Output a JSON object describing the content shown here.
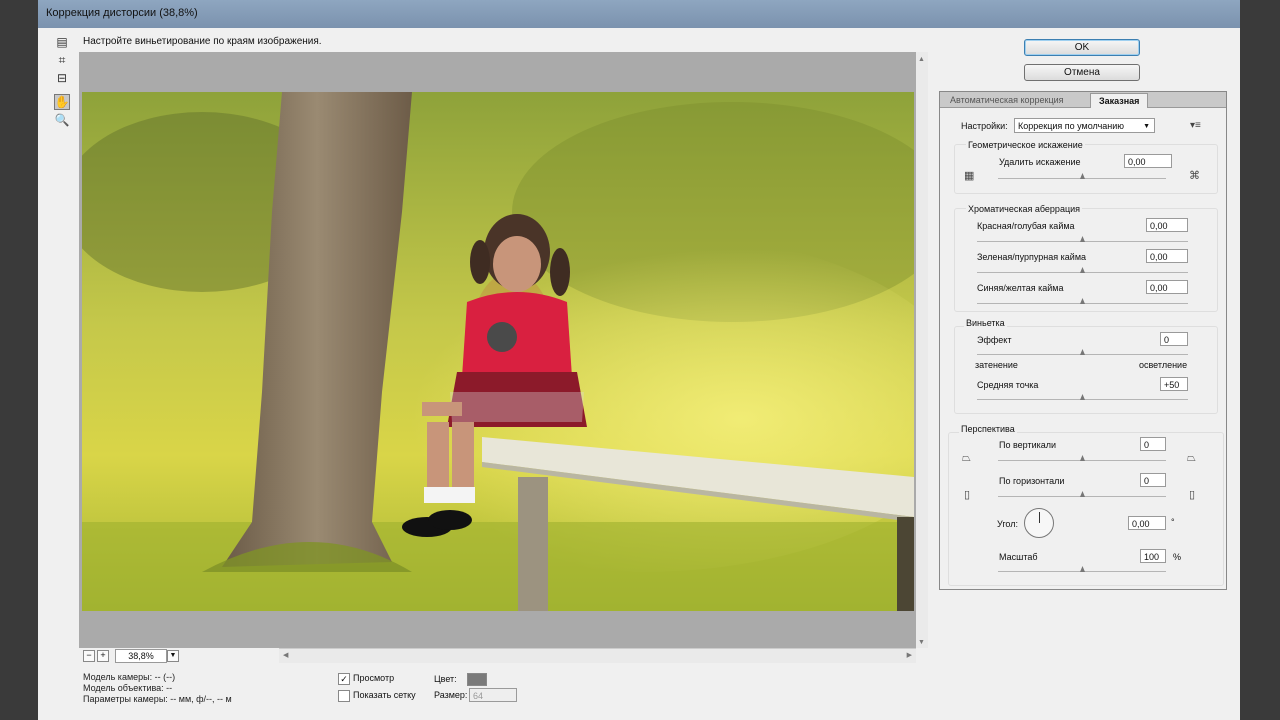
{
  "window": {
    "title": "Коррекция дисторсии (38,8%)",
    "hint": "Настройте виньетирование по краям изображения."
  },
  "buttons": {
    "ok": "OK",
    "cancel": "Отмена"
  },
  "tabs": {
    "auto": "Автоматическая коррекция",
    "custom": "Заказная"
  },
  "settings": {
    "label": "Настройки:",
    "value": "Коррекция по умолчанию"
  },
  "geometric": {
    "title": "Геометрическое искажение",
    "remove_label": "Удалить искажение",
    "remove_value": "0,00"
  },
  "chromatic": {
    "title": "Хроматическая аберрация",
    "red_cyan_label": "Красная/голубая кайма",
    "red_cyan_value": "0,00",
    "green_magenta_label": "Зеленая/пурпурная кайма",
    "green_magenta_value": "0,00",
    "blue_yellow_label": "Синяя/желтая кайма",
    "blue_yellow_value": "0,00"
  },
  "vignette": {
    "title": "Виньетка",
    "effect_label": "Эффект",
    "effect_value": "0",
    "darken_label": "затенение",
    "lighten_label": "осветление",
    "midpoint_label": "Средняя точка",
    "midpoint_value": "+50"
  },
  "perspective": {
    "title": "Перспектива",
    "vertical_label": "По вертикали",
    "vertical_value": "0",
    "horizontal_label": "По горизонтали",
    "horizontal_value": "0",
    "angle_label": "Угол:",
    "angle_value": "0,00",
    "angle_unit": "°",
    "scale_label": "Масштаб",
    "scale_value": "100",
    "scale_unit": "%"
  },
  "preview": {
    "zoom": "38,8%"
  },
  "info": {
    "camera_model": "Модель камеры: -- (--)",
    "lens_model": "Модель объектива: --",
    "camera_params": "Параметры камеры: -- мм, ф/--, -- м"
  },
  "options": {
    "preview_label": "Просмотр",
    "preview_checked": true,
    "show_grid_label": "Показать сетку",
    "show_grid_checked": false,
    "color_label": "Цвет:",
    "grid_color": "#7a7a7a",
    "size_label": "Размер:",
    "size_value": "64"
  },
  "colors": {
    "accent": "#3c7fb1",
    "titlebar": "#7b92ae"
  }
}
